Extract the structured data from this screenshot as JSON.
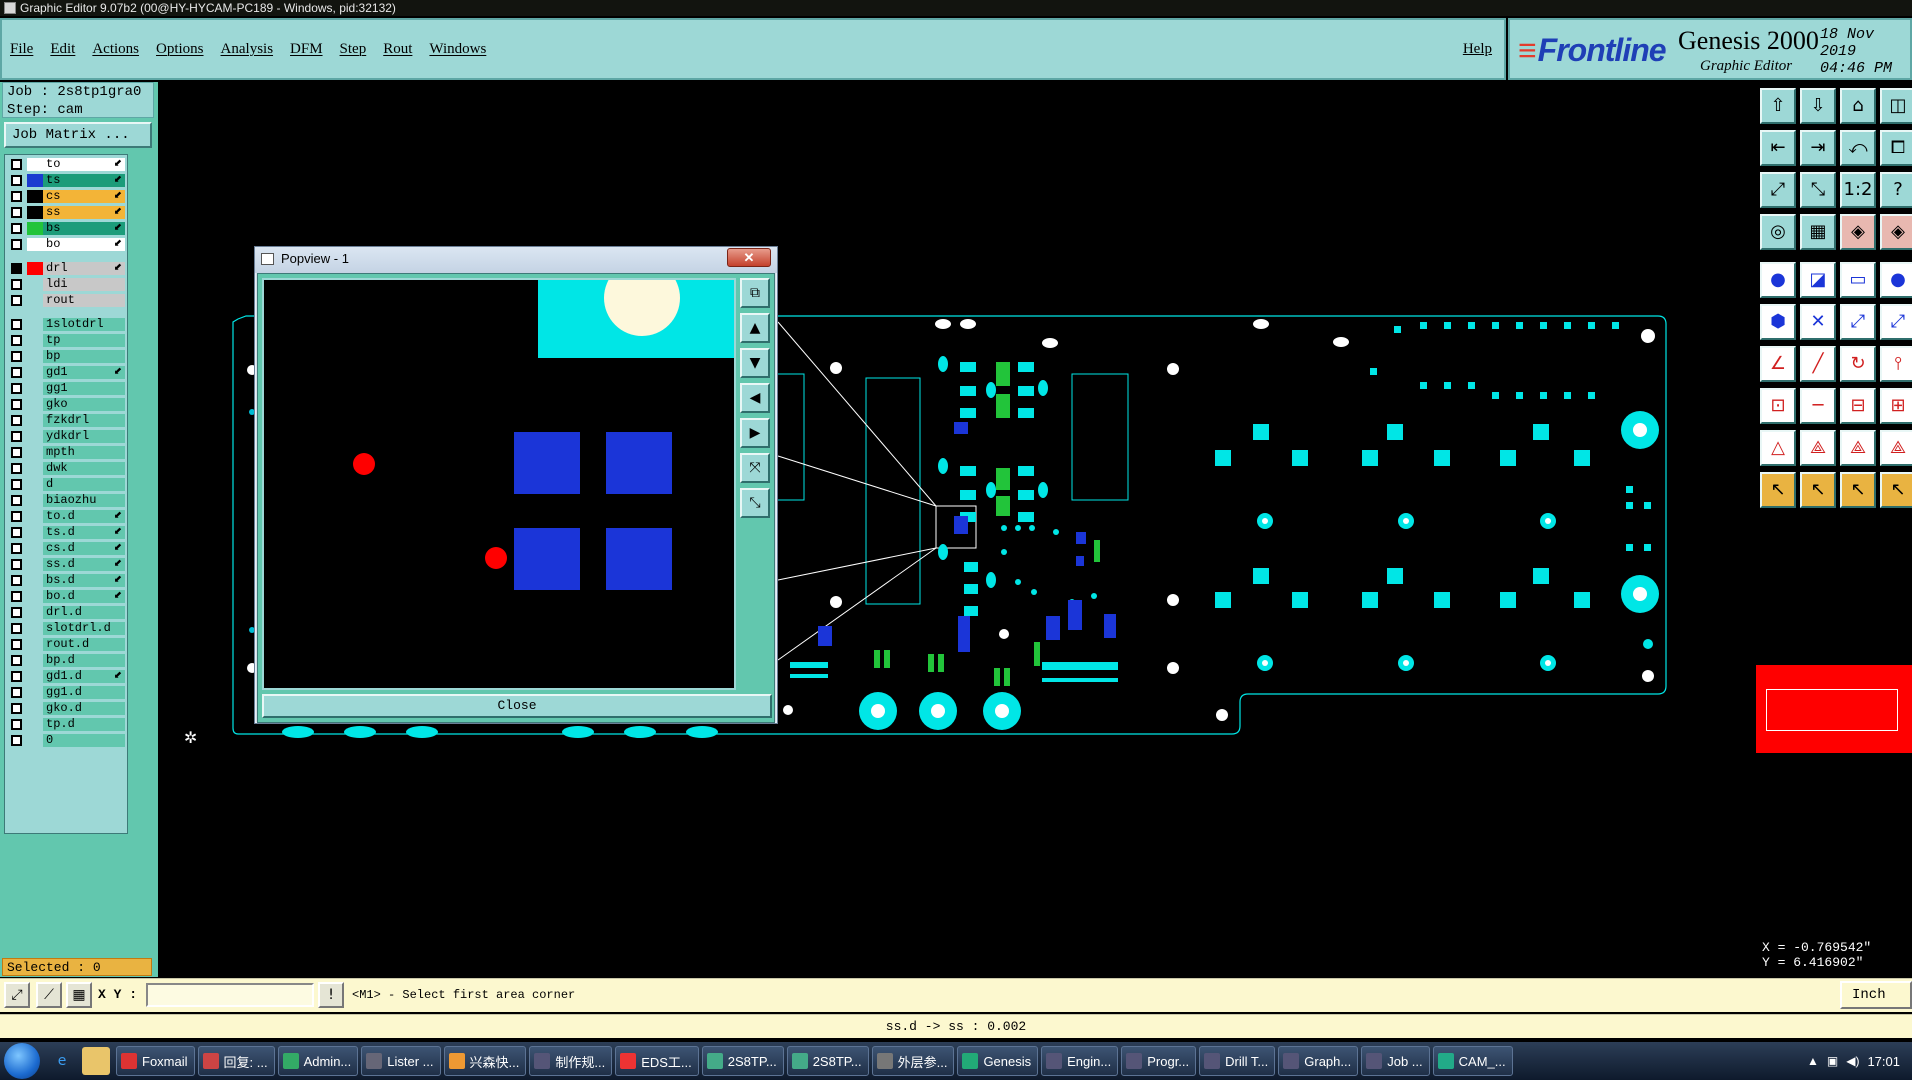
{
  "window_title": "Graphic Editor 9.07b2 (00@HY-HYCAM-PC189 - Windows, pid:32132)",
  "menu": [
    "File",
    "Edit",
    "Actions",
    "Options",
    "Analysis",
    "DFM",
    "Step",
    "Rout",
    "Windows"
  ],
  "help_label": "Help",
  "brand": {
    "logo": "Frontline",
    "product": "Genesis 2000",
    "subtitle": "Graphic Editor",
    "date": "18 Nov 2019",
    "time": "04:46 PM"
  },
  "job": {
    "job_line": "Job : 2s8tp1gra0",
    "step_line": "Step: cam",
    "matrix_button": "Job Matrix ..."
  },
  "layers": [
    {
      "name": "to",
      "color": "#ffffff",
      "bg": "#ffffff",
      "check": "off",
      "sel": true
    },
    {
      "name": "ts",
      "color": "#1b3bd0",
      "bg": "#1c9c7a",
      "check": "off",
      "sel": true
    },
    {
      "name": "cs",
      "color": "#000000",
      "bg": "#f3b437",
      "check": "off",
      "sel": true
    },
    {
      "name": "ss",
      "color": "#000000",
      "bg": "#f3b437",
      "check": "off",
      "sel": true
    },
    {
      "name": "bs",
      "color": "#22c43a",
      "bg": "#1c9c7a",
      "check": "off",
      "sel": true
    },
    {
      "name": "bo",
      "color": "#ffffff",
      "bg": "#ffffff",
      "check": "off",
      "sel": true
    },
    {
      "name": "drl",
      "color": "#ff0000",
      "bg": "#c8c8c8",
      "check": "on",
      "sel": true
    },
    {
      "name": "ldi",
      "color": "",
      "bg": "#c8c8c8",
      "check": "off",
      "sel": false
    },
    {
      "name": "rout",
      "color": "",
      "bg": "#c8c8c8",
      "check": "off",
      "sel": false
    },
    {
      "name": "1slotdrl",
      "color": "",
      "bg": "",
      "check": "off",
      "sel": false
    },
    {
      "name": "tp",
      "color": "",
      "bg": "",
      "check": "off",
      "sel": false
    },
    {
      "name": "bp",
      "color": "",
      "bg": "",
      "check": "off",
      "sel": false
    },
    {
      "name": "gd1",
      "color": "",
      "bg": "",
      "check": "off",
      "sel": true
    },
    {
      "name": "gg1",
      "color": "",
      "bg": "",
      "check": "off",
      "sel": false
    },
    {
      "name": "gko",
      "color": "",
      "bg": "",
      "check": "off",
      "sel": false
    },
    {
      "name": "fzkdrl",
      "color": "",
      "bg": "",
      "check": "off",
      "sel": false
    },
    {
      "name": "ydkdrl",
      "color": "",
      "bg": "",
      "check": "off",
      "sel": false
    },
    {
      "name": "mpth",
      "color": "",
      "bg": "",
      "check": "off",
      "sel": false
    },
    {
      "name": "dwk",
      "color": "",
      "bg": "",
      "check": "off",
      "sel": false
    },
    {
      "name": "d",
      "color": "",
      "bg": "",
      "check": "off",
      "sel": false
    },
    {
      "name": "biaozhu",
      "color": "",
      "bg": "",
      "check": "off",
      "sel": false
    },
    {
      "name": "to.d",
      "color": "",
      "bg": "",
      "check": "off",
      "sel": true
    },
    {
      "name": "ts.d",
      "color": "",
      "bg": "",
      "check": "off",
      "sel": true
    },
    {
      "name": "cs.d",
      "color": "",
      "bg": "",
      "check": "off",
      "sel": true
    },
    {
      "name": "ss.d",
      "color": "",
      "bg": "",
      "check": "off",
      "sel": true
    },
    {
      "name": "bs.d",
      "color": "",
      "bg": "",
      "check": "off",
      "sel": true
    },
    {
      "name": "bo.d",
      "color": "",
      "bg": "",
      "check": "off",
      "sel": true
    },
    {
      "name": "drl.d",
      "color": "",
      "bg": "",
      "check": "off",
      "sel": false
    },
    {
      "name": "slotdrl.d",
      "color": "",
      "bg": "",
      "check": "off",
      "sel": false
    },
    {
      "name": "rout.d",
      "color": "",
      "bg": "",
      "check": "off",
      "sel": false
    },
    {
      "name": "bp.d",
      "color": "",
      "bg": "",
      "check": "off",
      "sel": false
    },
    {
      "name": "gd1.d",
      "color": "",
      "bg": "",
      "check": "off",
      "sel": true
    },
    {
      "name": "gg1.d",
      "color": "",
      "bg": "",
      "check": "off",
      "sel": false
    },
    {
      "name": "gko.d",
      "color": "",
      "bg": "",
      "check": "off",
      "sel": false
    },
    {
      "name": "tp.d",
      "color": "",
      "bg": "",
      "check": "off",
      "sel": false
    },
    {
      "name": "0",
      "color": "",
      "bg": "",
      "check": "off",
      "sel": false
    }
  ],
  "selected_text": "Selected : 0",
  "popview": {
    "title": "Popview - 1",
    "close_label": "Close"
  },
  "coords": {
    "x": "X = -0.769542\"",
    "y": "Y = 6.416902\""
  },
  "bottom": {
    "xy_label": "X Y :",
    "xy_value": "",
    "message": "<M1> - Select first area corner",
    "units": "Inch"
  },
  "status_line": "ss.d -> ss : 0.002",
  "taskbar": {
    "items": [
      "Foxmail",
      "回复: ...",
      "Admin...",
      "Lister ...",
      "兴森快...",
      "制作规...",
      "EDS工...",
      "2S8TP...",
      "2S8TP...",
      "外层参...",
      "Genesis",
      "Engin...",
      "Progr...",
      "Drill T...",
      "Graph...",
      "Job ...",
      "CAM_..."
    ],
    "clock": "17:01"
  },
  "colors": {
    "teal_panel": "#62c7ae",
    "light_teal": "#9dd8d6",
    "board_cyan": "#00e6e6",
    "pad_blue": "#1b35d8",
    "pad_green": "#22c43a",
    "accent_orange": "#e9b341"
  }
}
